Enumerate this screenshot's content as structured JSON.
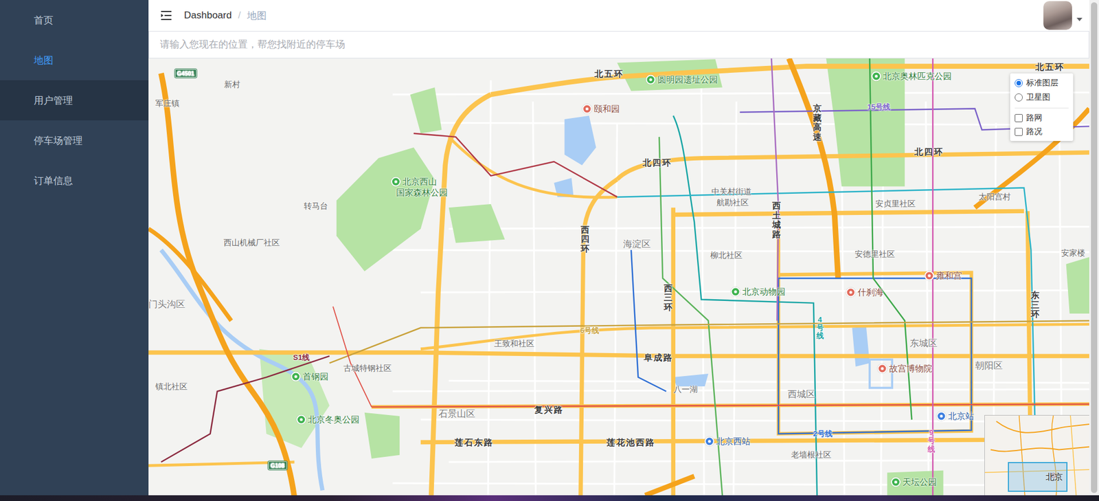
{
  "sidebar": {
    "items": [
      {
        "label": "首页",
        "selected": false,
        "highlighted": false
      },
      {
        "label": "地图",
        "selected": true,
        "highlighted": false
      },
      {
        "label": "用户管理",
        "selected": false,
        "highlighted": true
      },
      {
        "label": "停车场管理",
        "selected": false,
        "highlighted": false
      },
      {
        "label": "订单信息",
        "selected": false,
        "highlighted": false
      }
    ]
  },
  "header": {
    "breadcrumb": [
      {
        "label": "Dashboard",
        "current": false
      },
      {
        "label": "地图",
        "current": true
      }
    ],
    "separator": "/"
  },
  "search": {
    "placeholder": "请输入您现在的位置，帮您找附近的停车场"
  },
  "map": {
    "layers": [
      {
        "label": "标准图层",
        "kind": "radio",
        "selected": true
      },
      {
        "label": "卫星图",
        "kind": "radio",
        "selected": false
      },
      {
        "label": "路网",
        "kind": "checkbox",
        "selected": false
      },
      {
        "label": "路况",
        "kind": "checkbox",
        "selected": false
      }
    ],
    "minimap": {
      "label": "北京"
    },
    "labels": [
      {
        "text": "G4501",
        "kind": "shield"
      },
      {
        "text": "新村",
        "kind": "place"
      },
      {
        "text": "军庄镇",
        "kind": "place"
      },
      {
        "text": "北五环",
        "kind": "road"
      },
      {
        "text": "圆明园遗址公园",
        "kind": "park",
        "color": "#3fb34f"
      },
      {
        "text": "颐和园",
        "kind": "poi",
        "color": "#e26a5b"
      },
      {
        "text": "北京奥林匹克公园",
        "kind": "park",
        "color": "#3fb34f"
      },
      {
        "text": "北五环",
        "kind": "road"
      },
      {
        "text": "北四环",
        "kind": "road"
      },
      {
        "text": "北四环",
        "kind": "road"
      },
      {
        "text": "京藏高速",
        "kind": "vroad"
      },
      {
        "text": "15号线",
        "kind": "metro",
        "color": "#7b62c9"
      },
      {
        "text": "北京西山",
        "kind": "park",
        "color": "#3fb34f"
      },
      {
        "text": "国家森林公园",
        "kind": "parkname"
      },
      {
        "text": "中关村街道",
        "kind": "place"
      },
      {
        "text": "航勘社区",
        "kind": "place"
      },
      {
        "text": "西土城路",
        "kind": "vroad"
      },
      {
        "text": "安贞里社区",
        "kind": "place"
      },
      {
        "text": "太阳宫村",
        "kind": "place"
      },
      {
        "text": "西四环",
        "kind": "vroad"
      },
      {
        "text": "海淀区",
        "kind": "district"
      },
      {
        "text": "西山机械厂社区",
        "kind": "place"
      },
      {
        "text": "转马台",
        "kind": "place"
      },
      {
        "text": "柳北社区",
        "kind": "place"
      },
      {
        "text": "安德里社区",
        "kind": "place"
      },
      {
        "text": "安家楼",
        "kind": "place"
      },
      {
        "text": "雍和宫",
        "kind": "poi",
        "color": "#e26a5b"
      },
      {
        "text": "西三环",
        "kind": "vroad"
      },
      {
        "text": "北京动物园",
        "kind": "park",
        "color": "#3fb34f"
      },
      {
        "text": "什刹海",
        "kind": "poi",
        "color": "#e26a5b"
      },
      {
        "text": "东三环",
        "kind": "vroad"
      },
      {
        "text": "门头沟区",
        "kind": "district"
      },
      {
        "text": "王致和社区",
        "kind": "place"
      },
      {
        "text": "6号线",
        "kind": "metro",
        "color": "#c9a23b"
      },
      {
        "text": "4号线",
        "kind": "vmetro",
        "color": "#18a5a5"
      },
      {
        "text": "东城区",
        "kind": "district"
      },
      {
        "text": "S1线",
        "kind": "metro",
        "color": "#8c2b40"
      },
      {
        "text": "首钢园",
        "kind": "park",
        "color": "#3fb34f"
      },
      {
        "text": "古城特钢社区",
        "kind": "place"
      },
      {
        "text": "阜成路",
        "kind": "road"
      },
      {
        "text": "故宫博物院",
        "kind": "poi",
        "color": "#e26a5b"
      },
      {
        "text": "朝阳区",
        "kind": "district"
      },
      {
        "text": "镇北社区",
        "kind": "place"
      },
      {
        "text": "八一湖",
        "kind": "place"
      },
      {
        "text": "西城区",
        "kind": "district"
      },
      {
        "text": "复兴路",
        "kind": "road"
      },
      {
        "text": "石景山区",
        "kind": "district"
      },
      {
        "text": "北京冬奥公园",
        "kind": "park",
        "color": "#3fb34f"
      },
      {
        "text": "北京站",
        "kind": "station",
        "color": "#3d7fe0"
      },
      {
        "text": "2号线",
        "kind": "metro",
        "color": "#2f6fd4"
      },
      {
        "text": "9号线",
        "kind": "vmetro",
        "color": "#d357b0"
      },
      {
        "text": "莲石东路",
        "kind": "road"
      },
      {
        "text": "莲花池西路",
        "kind": "road"
      },
      {
        "text": "北京西站",
        "kind": "station",
        "color": "#3d7fe0"
      },
      {
        "text": "老墙根社区",
        "kind": "place"
      },
      {
        "text": "G108",
        "kind": "shield"
      },
      {
        "text": "天坛公园",
        "kind": "park",
        "color": "#3fb34f"
      }
    ]
  }
}
